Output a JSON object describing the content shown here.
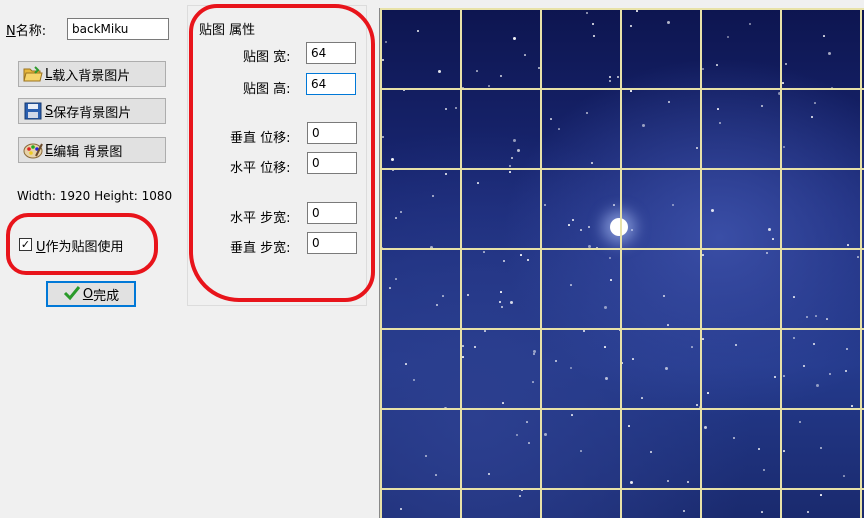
{
  "left": {
    "name_label_key": "N",
    "name_label": "名称:",
    "name_value": "backMiku",
    "load_button": {
      "key": "L",
      "label": "载入背景图片"
    },
    "save_button": {
      "key": "S",
      "label": "保存背景图片"
    },
    "edit_button": {
      "key": "E",
      "label": "编辑 背景图"
    },
    "size_text": "Width: 1920  Height: 1080",
    "use_as_texture": {
      "key": "U",
      "label": "作为贴图使用",
      "checked": true
    },
    "done_button": {
      "key": "O",
      "label": "完成"
    }
  },
  "props": {
    "group_title": "贴图 属性",
    "tile_width_label": "贴图 宽:",
    "tile_width_value": "64",
    "tile_height_label": "贴图 高:",
    "tile_height_value": "64",
    "v_offset_label": "垂直 位移:",
    "v_offset_value": "0",
    "h_offset_label": "水平 位移:",
    "h_offset_value": "0",
    "h_step_label": "水平 步宽:",
    "h_step_value": "0",
    "v_step_label": "垂直 步宽:",
    "v_step_value": "0"
  },
  "colors": {
    "annotation": "#e8141b",
    "grid_line": "#e8e2a8",
    "sky": "#1b2a78"
  }
}
